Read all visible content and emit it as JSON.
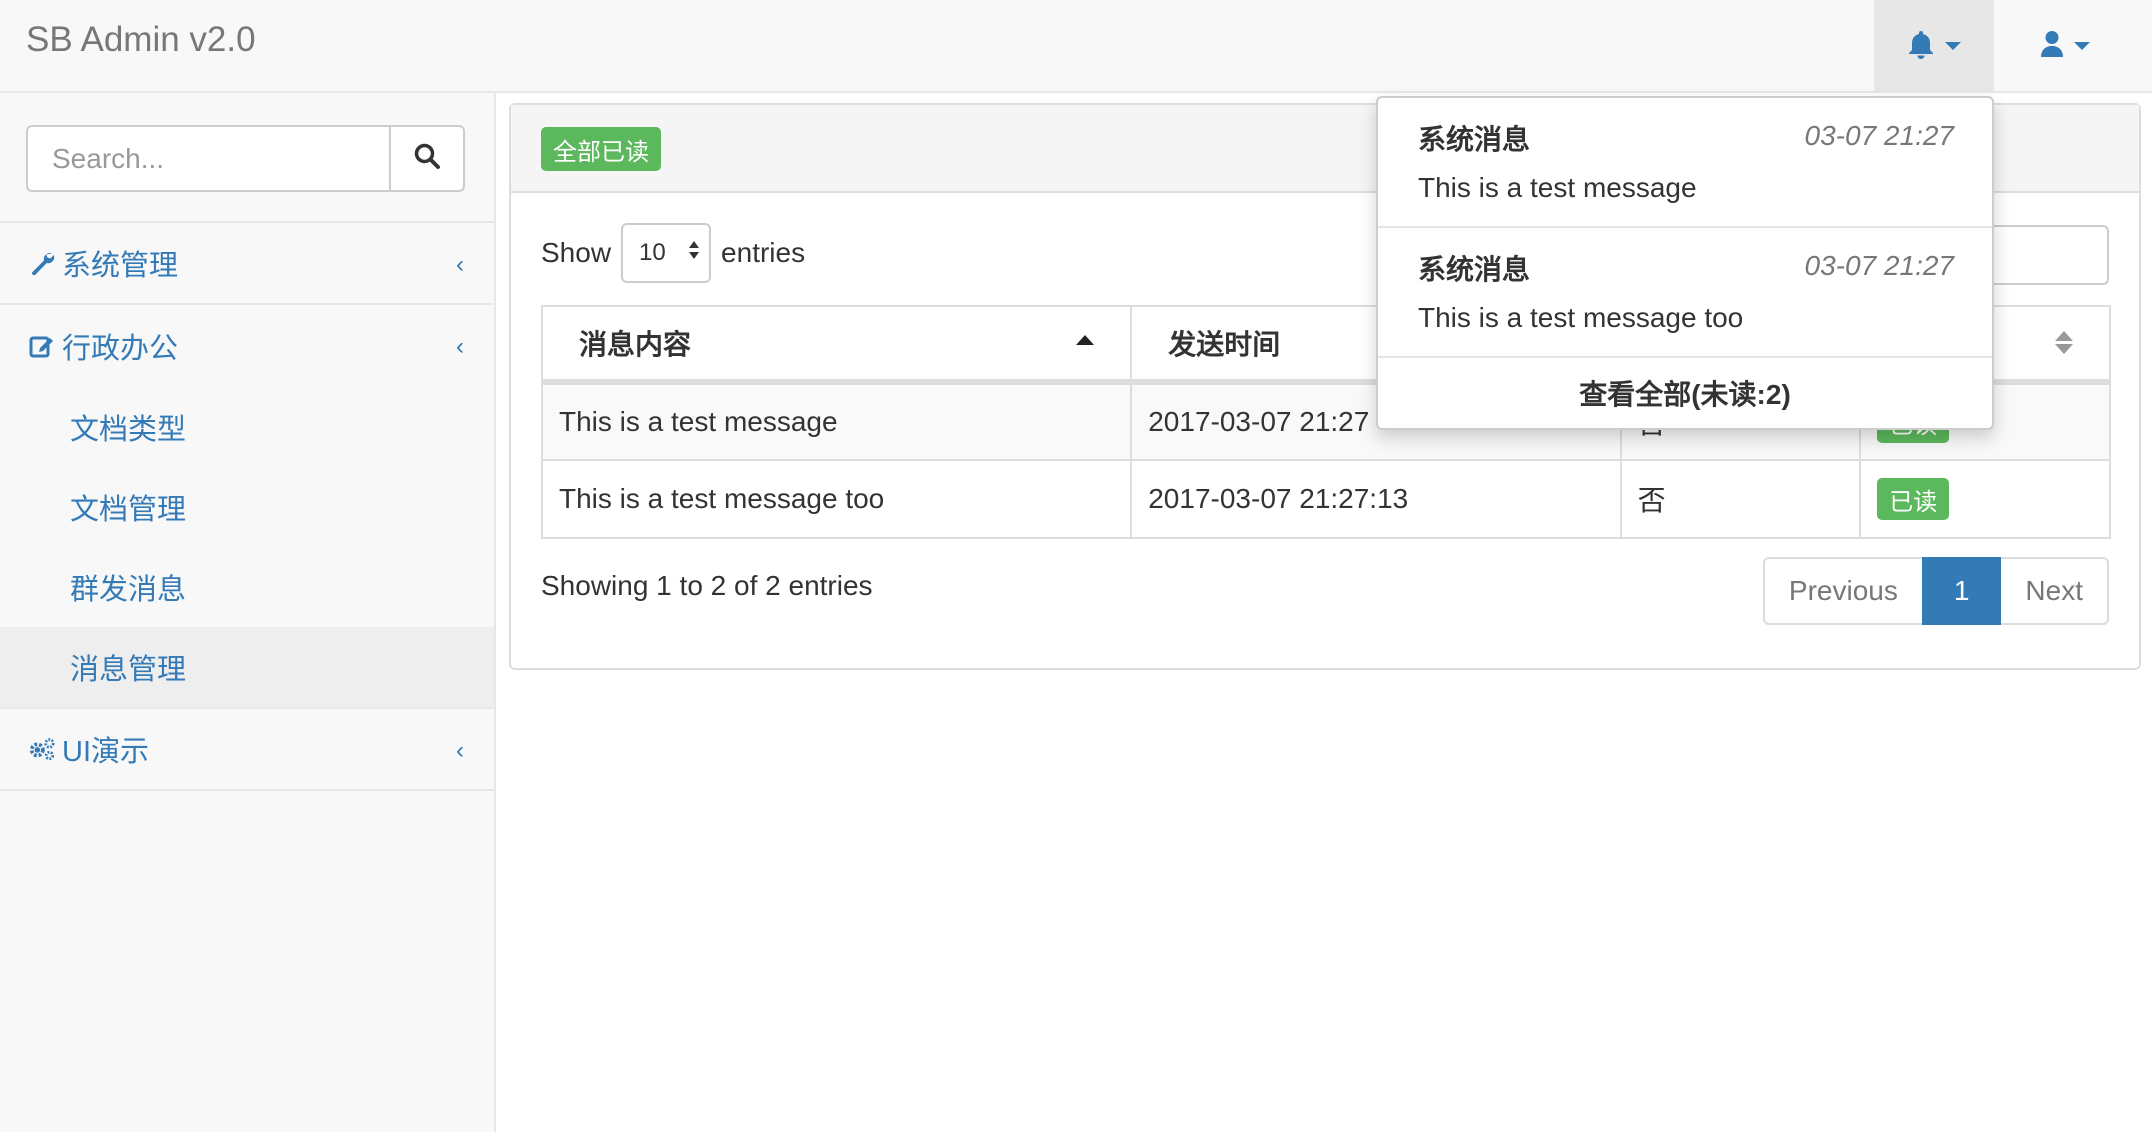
{
  "brand": "SB Admin v2.0",
  "navbar": {
    "bell_icon": "bell-icon",
    "user_icon": "user-icon"
  },
  "search": {
    "placeholder": "Search..."
  },
  "sidebar": {
    "menu": [
      {
        "label": "系统管理",
        "icon": "wrench-icon"
      },
      {
        "label": "行政办公",
        "icon": "edit-icon"
      }
    ],
    "submenu": [
      "文档类型",
      "文档管理",
      "群发消息",
      "消息管理"
    ],
    "active_submenu": "消息管理",
    "ui_demo": {
      "label": "UI演示",
      "icon": "gears-icon"
    }
  },
  "panel": {
    "mark_all_read": "全部已读",
    "show_label": "Show",
    "page_length": "10",
    "entries_label": "entries",
    "columns": [
      "消息内容",
      "发送时间",
      "",
      ""
    ],
    "rows": [
      {
        "content": "This is a test message",
        "time": "2017-03-07 21:27",
        "read_flag": "否",
        "status": "已读"
      },
      {
        "content": "This is a test message too",
        "time": "2017-03-07 21:27:13",
        "read_flag": "否",
        "status": "已读"
      }
    ],
    "info": "Showing 1 to 2 of 2 entries",
    "pagination": {
      "previous": "Previous",
      "current": "1",
      "next": "Next"
    }
  },
  "notifications": {
    "items": [
      {
        "title": "系统消息",
        "time": "03-07 21:27",
        "message": "This is a test message"
      },
      {
        "title": "系统消息",
        "time": "03-07 21:27",
        "message": "This is a test message too"
      }
    ],
    "footer": "查看全部(未读:2)"
  },
  "colors": {
    "link": "#337ab7",
    "success": "#5cb85c",
    "navbar_bg": "#f8f8f8"
  }
}
